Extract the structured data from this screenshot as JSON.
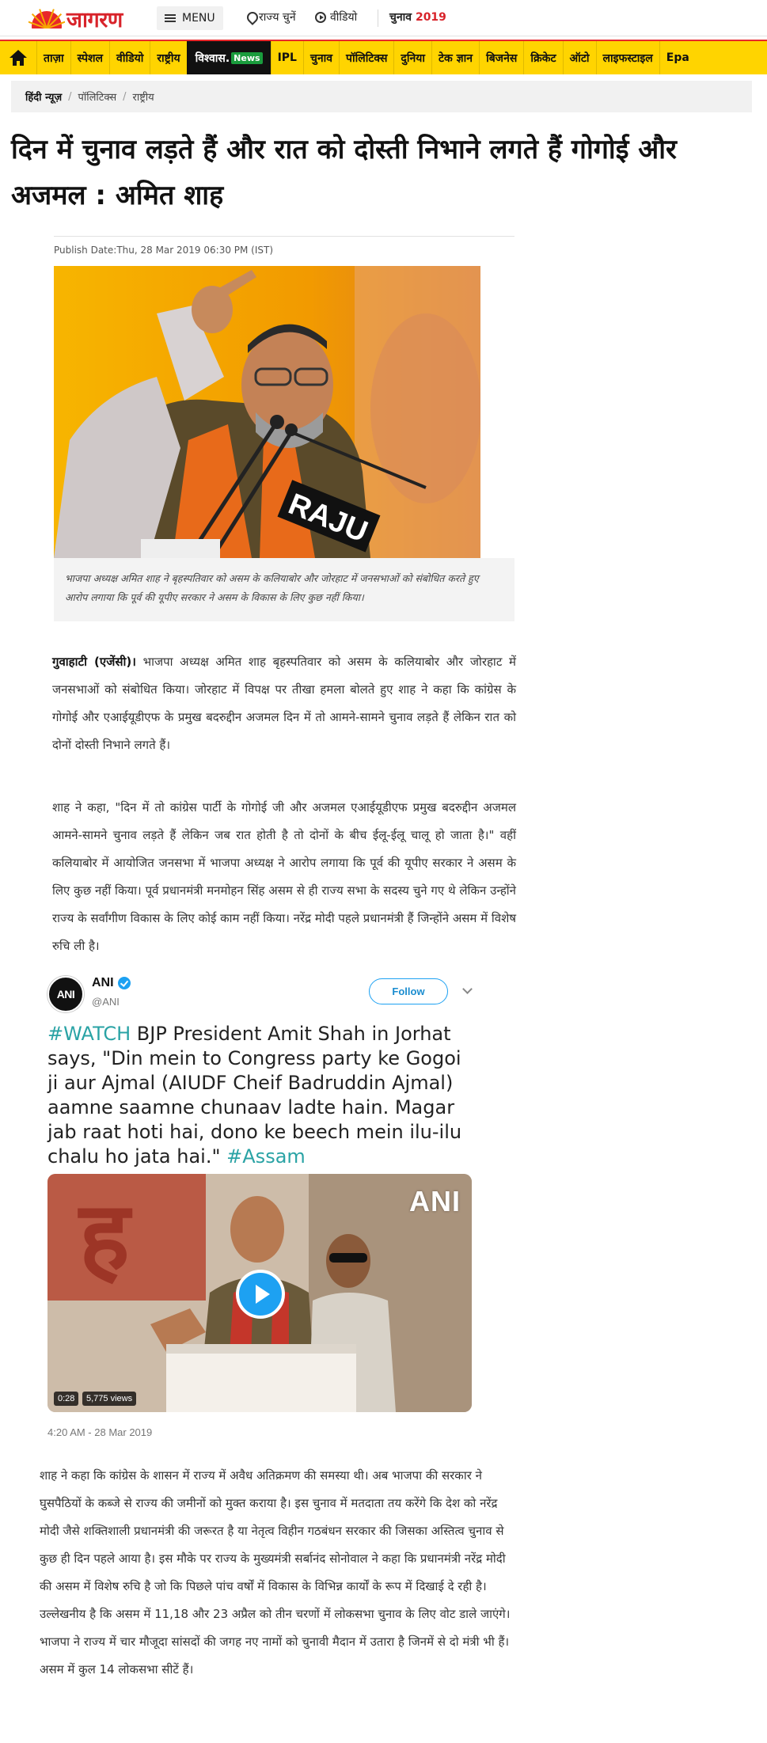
{
  "header": {
    "logo_text": "जागरण",
    "menu_label": "MENU",
    "state_label": "राज्य चुनें",
    "video_label": "वीडियो",
    "election_label": "चुनाव",
    "election_year": "2019"
  },
  "nav": {
    "items": [
      "ताज़ा",
      "स्पेशल",
      "वीडियो",
      "राष्ट्रीय",
      "IPL",
      "चुनाव",
      "पॉलिटिक्स",
      "दुनिया",
      "टेक ज्ञान",
      "बिजनेस",
      "क्रिकेट",
      "ऑटो",
      "लाइफस्टाइल",
      "Epa"
    ],
    "brand_label": "विश्वास.",
    "brand_suffix": "News"
  },
  "breadcrumb": {
    "items": [
      "हिंदी न्यूज़",
      "पॉलिटिक्स",
      "राष्ट्रीय"
    ],
    "separator": "/"
  },
  "article": {
    "title": "दिन में चुनाव लड़ते हैं और रात को दोस्ती निभाने लगते हैं गोगोई और अजमल : अमित शाह",
    "publish_date": "Publish Date:Thu, 28 Mar 2019 06:30 PM (IST)",
    "image_caption": "भाजपा अध्यक्ष अमित शाह ने बृहस्पतिवार को असम के कलियाबोर और जोरहाट में जनसभाओं को संबोधित करते हुए आरोप लगाया कि पूर्व की यूपीए सरकार ने असम के विकास के लिए कुछ नहीं किया।",
    "image_podium_text": "RAJU",
    "dateline": "गुवाहाटी (एजेंसी)।",
    "para1": " भाजपा अध्यक्ष अमित शाह बृहस्पतिवार को असम के कलियाबोर और जोरहाट में जनसभाओं को संबोधित किया। जोरहाट में विपक्ष पर तीखा हमला बोलते हुए शाह ने कहा कि कांग्रेस के गोगोई और एआईयूडीएफ के प्रमुख बदरुद्दीन अजमल दिन में तो आमने-सामने चुनाव लड़ते हैं लेकिन रात को दोनों दोस्ती निभाने लगते हैं।",
    "para2": "शाह ने कहा, \"दिन में तो कांग्रेस पार्टी के गोगोई जी और अजमल एआईयूडीएफ प्रमुख बदरुद्दीन अजमल आमने-सामने चुनाव लड़ते हैं लेकिन जब रात होती है तो दोनों के बीच ईलू-ईलू चालू हो जाता है।\" वहीं कलियाबोर में आयोजित जनसभा में भाजपा अध्यक्ष ने आरोप लगाया कि पूर्व की यूपीए सरकार ने असम के लिए कुछ नहीं किया। पूर्व प्रधानमंत्री मनमोहन सिंह असम से ही राज्य सभा के सदस्य चुने गए थे लेकिन उन्होंने राज्य के सर्वांगीण विकास के लिए कोई काम नहीं किया। नरेंद्र मोदी पहले प्रधानमंत्री हैं जिन्होंने असम में विशेष रुचि ली है।",
    "para3": "शाह ने कहा कि कांग्रेस के शासन में राज्य में अवैध अतिक्रमण की समस्या थी। अब भाजपा की सरकार ने घुसपैठियों के कब्जे से राज्य की जमीनों को मुक्त कराया है। इस चुनाव में मतदाता तय करेंगे कि देश को नरेंद्र मोदी जैसे शक्तिशाली प्रधानमंत्री की जरूरत है या नेतृत्व विहीन गठबंधन सरकार की जिसका अस्तित्व चुनाव से कुछ ही दिन पहले आया है। इस मौके पर राज्य के मुख्यमंत्री सर्बानंद सोनोवाल ने कहा कि प्रधानमंत्री नरेंद्र मोदी की असम में विशेष रुचि है जो कि पिछले पांच वर्षों में विकास के विभिन्न कार्यों के रूप में दिखाई दे रही है।उल्लेखनीय है कि असम में 11,18 और 23 अप्रैल को तीन चरणों में लोकसभा चुनाव के लिए वोट डाले जाएंगे।भाजपा ने राज्य में चार मौजूदा सांसदों की जगह नए नामों को चुनावी मैदान में उतारा है जिनमें से दो मंत्री भी हैं। असम में कुल 14 लोकसभा सीटें हैं।"
  },
  "tweet": {
    "avatar_text": "ANI",
    "name": "ANI",
    "handle": "@ANI",
    "follow_label": "Follow",
    "hashtag1": "#WATCH",
    "text": " BJP President Amit Shah in Jorhat says, \"Din mein to Congress party ke Gogoi ji aur Ajmal (AIUDF Cheif Badruddin Ajmal) aamne saamne chunaav ladte hain. Magar jab raat hoti hai, dono ke beech mein ilu-ilu chalu ho jata hai.\" ",
    "hashtag2": "#Assam",
    "video_watermark": "ANI",
    "video_duration": "0:28",
    "video_views": "5,775 views",
    "timestamp": "4:20 AM - 28 Mar 2019"
  },
  "colors": {
    "brand_red": "#d8232a",
    "nav_yellow": "#ffd400",
    "twitter_blue": "#1da1f2",
    "hashtag": "#2aa3a5"
  }
}
